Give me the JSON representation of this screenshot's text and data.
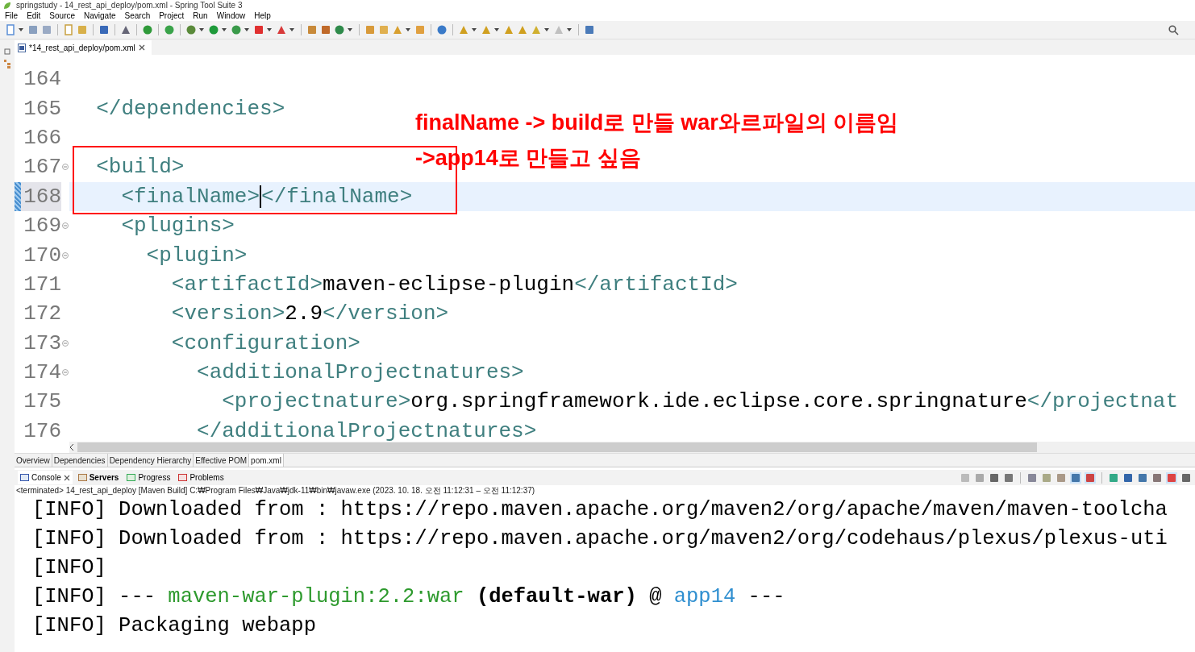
{
  "window": {
    "title": "springstudy - 14_rest_api_deploy/pom.xml - Spring Tool Suite 3"
  },
  "menu": [
    "File",
    "Edit",
    "Source",
    "Navigate",
    "Search",
    "Project",
    "Run",
    "Window",
    "Help"
  ],
  "editor": {
    "tab": {
      "label": "*14_rest_api_deploy/pom.xml",
      "selected": true
    },
    "lines": [
      {
        "number": "164",
        "fold": false,
        "current": false
      },
      {
        "number": "165",
        "fold": false,
        "current": false,
        "segments": [
          {
            "kind": "tag",
            "text": "  </dependencies>"
          }
        ]
      },
      {
        "number": "166",
        "fold": false,
        "current": false
      },
      {
        "number": "167",
        "fold": true,
        "current": false,
        "segments": [
          {
            "kind": "tag",
            "text": "  <build>"
          }
        ]
      },
      {
        "number": "168",
        "fold": false,
        "current": true,
        "segments": [
          {
            "kind": "tag",
            "text": "    <finalName>"
          },
          {
            "kind": "caret"
          },
          {
            "kind": "tag",
            "text": "</finalName>"
          }
        ]
      },
      {
        "number": "169",
        "fold": true,
        "current": false,
        "segments": [
          {
            "kind": "tag",
            "text": "    <plugins>"
          }
        ]
      },
      {
        "number": "170",
        "fold": true,
        "current": false,
        "segments": [
          {
            "kind": "tag",
            "text": "      <plugin>"
          }
        ]
      },
      {
        "number": "171",
        "fold": false,
        "current": false,
        "segments": [
          {
            "kind": "tag",
            "text": "        <artifactId>"
          },
          {
            "kind": "text",
            "text": "maven-eclipse-plugin"
          },
          {
            "kind": "tag",
            "text": "</artifactId>"
          }
        ]
      },
      {
        "number": "172",
        "fold": false,
        "current": false,
        "segments": [
          {
            "kind": "tag",
            "text": "        <version>"
          },
          {
            "kind": "text",
            "text": "2.9"
          },
          {
            "kind": "tag",
            "text": "</version>"
          }
        ]
      },
      {
        "number": "173",
        "fold": true,
        "current": false,
        "segments": [
          {
            "kind": "tag",
            "text": "        <configuration>"
          }
        ]
      },
      {
        "number": "174",
        "fold": true,
        "current": false,
        "segments": [
          {
            "kind": "tag",
            "text": "          <additionalProjectnatures>"
          }
        ]
      },
      {
        "number": "175",
        "fold": false,
        "current": false,
        "segments": [
          {
            "kind": "tag",
            "text": "            <projectnature>"
          },
          {
            "kind": "text",
            "text": "org.springframework.ide.eclipse.core.springnature"
          },
          {
            "kind": "tag",
            "text": "</projectnat"
          }
        ]
      },
      {
        "number": "176",
        "fold": false,
        "current": false,
        "segments": [
          {
            "kind": "tag",
            "text": "          </additionalProjectnatures>"
          }
        ]
      }
    ],
    "annotation": [
      "finalName -> build로 만들 war와르파일의 이름임",
      "->app14로 만들고 싶음"
    ]
  },
  "editor_tabs": [
    {
      "label": "Overview",
      "selected": false
    },
    {
      "label": "Dependencies",
      "selected": false
    },
    {
      "label": "Dependency Hierarchy",
      "selected": false
    },
    {
      "label": "Effective POM",
      "selected": false
    },
    {
      "label": "pom.xml",
      "selected": true
    }
  ],
  "console": {
    "tabs": [
      {
        "label": "Console",
        "selected": true,
        "closable": true,
        "bold": false
      },
      {
        "label": "Servers",
        "selected": false,
        "closable": false,
        "bold": true
      },
      {
        "label": "Progress",
        "selected": false,
        "closable": false,
        "bold": false
      },
      {
        "label": "Problems",
        "selected": false,
        "closable": false,
        "bold": false
      }
    ],
    "status": "<terminated> 14_rest_api_deploy [Maven Build] C:₩Program Files₩Java₩jdk-11₩bin₩javaw.exe  (2023. 10. 18. 오전 11:12:31 – 오전 11:12:37)",
    "lines": [
      [
        {
          "kind": "plain",
          "text": "[INFO] Downloaded from : https://repo.maven.apache.org/maven2/org/apache/maven/maven-toolcha"
        }
      ],
      [
        {
          "kind": "plain",
          "text": "[INFO] Downloaded from : https://repo.maven.apache.org/maven2/org/codehaus/plexus/plexus-uti"
        }
      ],
      [
        {
          "kind": "plain",
          "text": "[INFO]"
        }
      ],
      [
        {
          "kind": "plain",
          "text": "[INFO] --- "
        },
        {
          "kind": "plugin",
          "text": "maven-war-plugin:2.2:war"
        },
        {
          "kind": "bold",
          "text": " (default-war)"
        },
        {
          "kind": "plain",
          "text": " @ "
        },
        {
          "kind": "project",
          "text": "app14"
        },
        {
          "kind": "plain",
          "text": " ---"
        }
      ],
      [
        {
          "kind": "plain",
          "text": "[INFO] Packaging webapp"
        }
      ]
    ]
  }
}
